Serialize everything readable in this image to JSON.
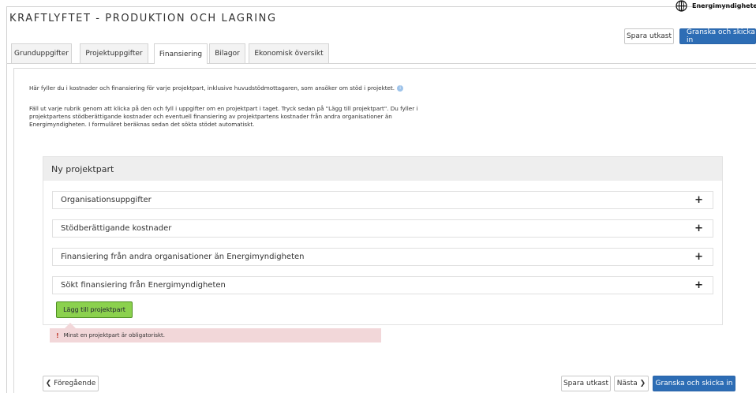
{
  "app": {
    "title": "KRAFTLYFTET - PRODUKTION OCH LAGRING",
    "logo_text": "Energimyndigheten"
  },
  "header": {
    "save_draft": "Spara utkast",
    "review_submit": "Granska och skicka in"
  },
  "tabs": [
    {
      "label": "Grunduppgifter",
      "active": false
    },
    {
      "label": "Projektuppgifter",
      "active": false
    },
    {
      "label": "Finansiering",
      "active": true
    },
    {
      "label": "Bilagor",
      "active": false
    },
    {
      "label": "Ekonomisk översikt",
      "active": false
    }
  ],
  "intro": {
    "line1": "Här fyller du i kostnader och finansiering för varje projektpart, inklusive huvudstödmottagaren, som ansöker om stöd i projektet.",
    "para2_line1": "Fäll ut varje rubrik genom att klicka på den och fyll i uppgifter om en projektpart i taget. Tryck sedan på \"Lägg till projektpart\". Du fyller i",
    "para2_line2": "projektpartens stödberättigande kostnader och eventuell finansiering av projektpartens kostnader från andra organisationer än",
    "para2_line3": "Energimyndigheten. I formuläret beräknas sedan det sökta stödet automatiskt."
  },
  "panel": {
    "title": "Ny projektpart",
    "sections": [
      {
        "label": "Organisationsuppgifter",
        "toggle": "+"
      },
      {
        "label": "Stödberättigande kostnader",
        "toggle": "+"
      },
      {
        "label": "Finansiering från andra organisationer än Energimyndigheten",
        "toggle": "+"
      },
      {
        "label": "Sökt finansiering från Energimyndigheten",
        "toggle": "+"
      }
    ],
    "add_button": "Lägg till projektpart"
  },
  "error": {
    "mark": "!",
    "message": "Minst en projektpart är obligatoriskt."
  },
  "footer": {
    "previous": "❮ Föregående",
    "save_draft": "Spara utkast",
    "next": "Nästa ❯",
    "review_submit": "Granska och skicka in"
  },
  "colors": {
    "primary": "#2d6db5",
    "add_button": "#8bd14e",
    "error_bg": "#f2d7d9"
  }
}
